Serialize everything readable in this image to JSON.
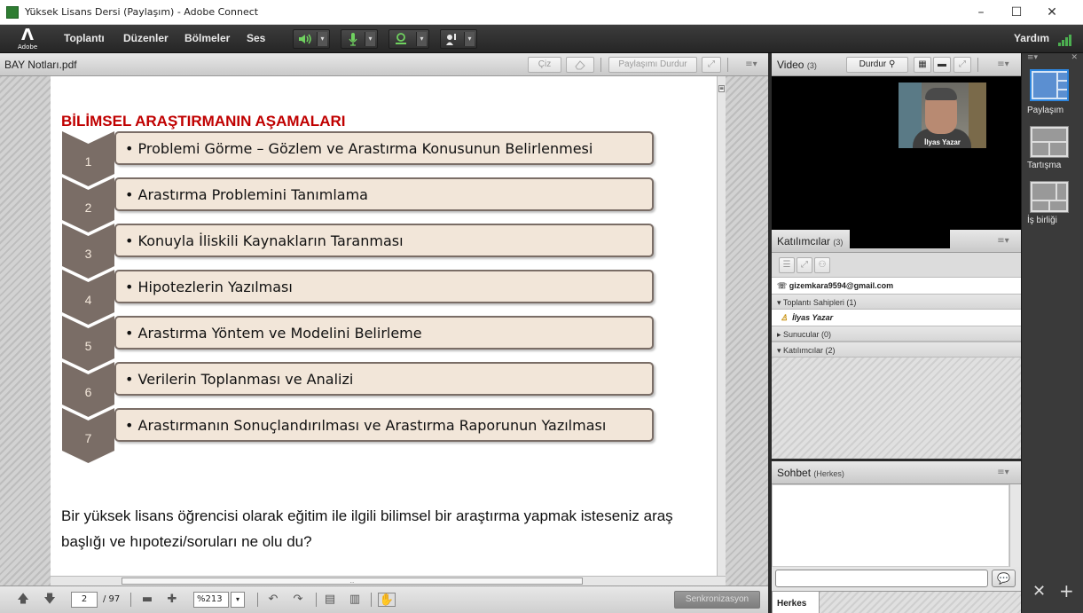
{
  "window": {
    "title": "Yüksek Lisans Dersi (Paylaşım) - Adobe Connect",
    "controls": [
      "–",
      "☐",
      "✕"
    ]
  },
  "menubar": {
    "logo_text": "Adobe",
    "items": [
      "Toplantı",
      "Düzenler",
      "Bölmeler",
      "Ses"
    ],
    "help": "Yardım",
    "accent": "#4caf50"
  },
  "share_pod": {
    "title": "BAY Notları.pdf",
    "buttons": {
      "draw": "Çiz",
      "stop_sharing": "Paylaşımı Durdur"
    },
    "slide": {
      "title": "BİLİMSEL ARAŞTIRMANIN AŞAMALARI",
      "title_color": "#c00000",
      "steps": [
        {
          "num": "1",
          "text": "• Problemi Görme – Gözlem ve Arastırma Konusunun Belirlenmesi"
        },
        {
          "num": "2",
          "text": "• Arastırma Problemini Tanımlama"
        },
        {
          "num": "3",
          "text": "• Konuyla İliskili Kaynakların Taranması"
        },
        {
          "num": "4",
          "text": "• Hipotezlerin Yazılması"
        },
        {
          "num": "5",
          "text": "• Arastırma Yöntem ve Modelini Belirleme"
        },
        {
          "num": "6",
          "text": "• Verilerin Toplanması ve Analizi"
        },
        {
          "num": "7",
          "text": "• Arastırmanın Sonuçlandırılması ve Arastırma Raporunun Yazılması"
        }
      ],
      "question_line1": "Bir yüksek lisans öğrencisi olarak eğitim ile ilgili bilimsel bir araştırma yapmak isteseniz araş",
      "question_line2": "başlığı ve hıpotezi/soruları ne olu du?"
    },
    "footer": {
      "page_current": "2",
      "page_total": "/ 97",
      "zoom": "%213",
      "sync_label": "Senkronizasyon"
    }
  },
  "video_pod": {
    "title": "Video",
    "count": "(3)",
    "stop_label": "Durdur",
    "participant_label": "İlyas Yazar"
  },
  "attendees_pod": {
    "title": "Katılımcılar",
    "count": "(3)",
    "phone_user": "gizemkara9594@gmail.com",
    "groups": {
      "hosts": "Toplantı Sahipleri (1)",
      "host_name": "İlyas Yazar",
      "presenters": "Sunucular (0)",
      "participants": "Katılımcılar (2)"
    }
  },
  "chat_pod": {
    "title": "Sohbet",
    "scope": "(Herkes)",
    "tab": "Herkes",
    "send_icon": "speech-bubble-icon"
  },
  "layouts": {
    "items": [
      "Paylaşım",
      "Tartışma",
      "İş birliği"
    ],
    "selected_color": "#2e86de"
  }
}
